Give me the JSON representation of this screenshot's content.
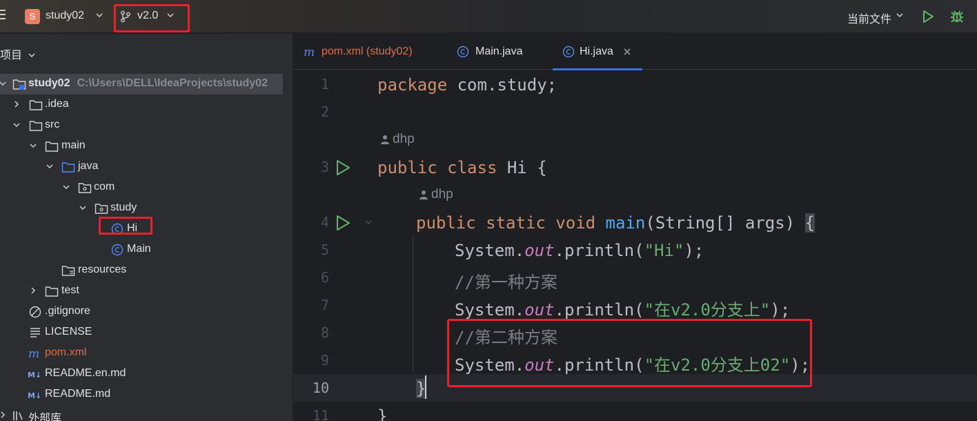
{
  "titlebar": {
    "project_initial": "S",
    "project_name": "study02",
    "branch": "v2.0",
    "run_config": "当前文件"
  },
  "project_panel": {
    "header": "项目",
    "tree": [
      {
        "label": "study02",
        "path": "C:\\Users\\DELL\\IdeaProjects\\study02",
        "icon": "module-folder-icon"
      },
      {
        "label": ".idea",
        "icon": "folder-icon"
      },
      {
        "label": "src",
        "icon": "folder-icon"
      },
      {
        "label": "main",
        "icon": "folder-icon"
      },
      {
        "label": "java",
        "icon": "source-folder-icon"
      },
      {
        "label": "com",
        "icon": "package-icon"
      },
      {
        "label": "study",
        "icon": "package-icon"
      },
      {
        "label": "Hi",
        "icon": "java-class-icon"
      },
      {
        "label": "Main",
        "icon": "java-class-icon"
      },
      {
        "label": "resources",
        "icon": "resources-folder-icon"
      },
      {
        "label": "test",
        "icon": "folder-icon"
      },
      {
        "label": ".gitignore",
        "icon": "ignore-file-icon"
      },
      {
        "label": "LICENSE",
        "icon": "text-file-icon"
      },
      {
        "label": "pom.xml",
        "icon": "maven-icon"
      },
      {
        "label": "README.en.md",
        "icon": "markdown-icon"
      },
      {
        "label": "README.md",
        "icon": "markdown-icon"
      },
      {
        "label": "外部库",
        "icon": "library-icon"
      }
    ]
  },
  "editor": {
    "tabs": [
      {
        "label": "pom.xml (study02)",
        "icon": "maven-icon"
      },
      {
        "label": "Main.java",
        "icon": "java-class-icon"
      },
      {
        "label": "Hi.java",
        "icon": "java-class-icon",
        "active": true
      }
    ],
    "author_hint": "dhp",
    "line_numbers": [
      "1",
      "2",
      "3",
      "4",
      "5",
      "6",
      "7",
      "8",
      "9",
      "10",
      "11"
    ],
    "code": {
      "l1_kw": "package",
      "l1_rest": " com.study;",
      "l3_kw": "public class",
      "l3_rest": " Hi {",
      "l4_kw": "public static void",
      "l4_fn": "main",
      "l4_rest": "(String[] args) ",
      "l4_brace": "{",
      "sys": "System.",
      "out": "out",
      "println_open": ".println(",
      "close": ");",
      "l5_str": "\"Hi\"",
      "l6_cmt": "//第一种方案",
      "l7_str": "\"在v2.0分支上\"",
      "l8_cmt": "//第二种方案",
      "l9_str": "\"在v2.0分支上02\"",
      "l10_brace": "}",
      "l11_brace": "}"
    }
  },
  "colors": {
    "highlight_box": "#e8222a",
    "keyword": "#cf8e6d",
    "string": "#6aab73",
    "function": "#56a8f5",
    "field": "#c77dbb",
    "comment": "#7a7e85",
    "run": "#5fb865",
    "accent": "#3574f0"
  }
}
